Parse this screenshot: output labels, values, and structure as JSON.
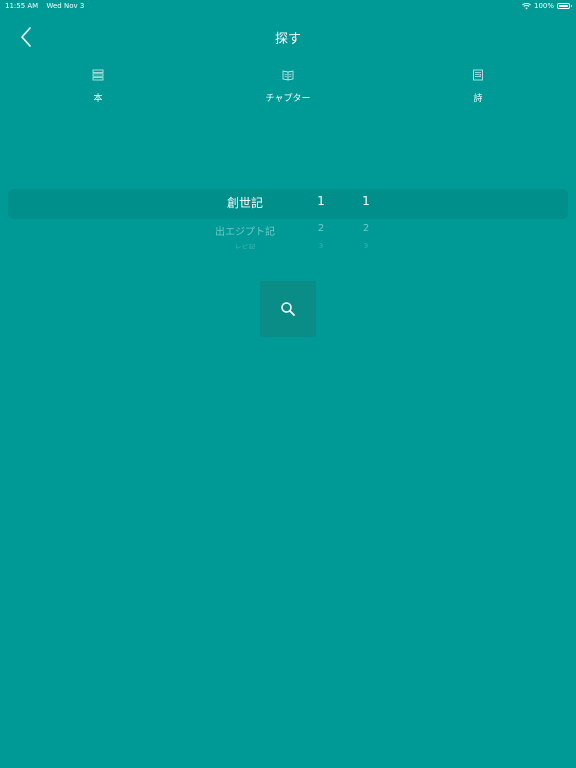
{
  "status_bar": {
    "time": "11:55 AM",
    "date": "Wed Nov 3",
    "battery": "100%"
  },
  "nav": {
    "title": "探す",
    "back_icon": "chevron-left-icon"
  },
  "tabs": [
    {
      "label": "本",
      "icon": "book-stack-icon"
    },
    {
      "label": "チャプター",
      "icon": "open-book-icon"
    },
    {
      "label": "詩",
      "icon": "document-icon"
    }
  ],
  "picker": {
    "rows": [
      {
        "book": "創世記",
        "chapter": "1",
        "verse": "1"
      },
      {
        "book": "出エジプト記",
        "chapter": "2",
        "verse": "2"
      },
      {
        "book": "レビ記",
        "chapter": "3",
        "verse": "3"
      }
    ]
  },
  "search_button": {
    "icon": "magnifier-icon"
  },
  "colors": {
    "background": "#009a96",
    "button": "#0a8c87",
    "text": "#ffffff"
  }
}
